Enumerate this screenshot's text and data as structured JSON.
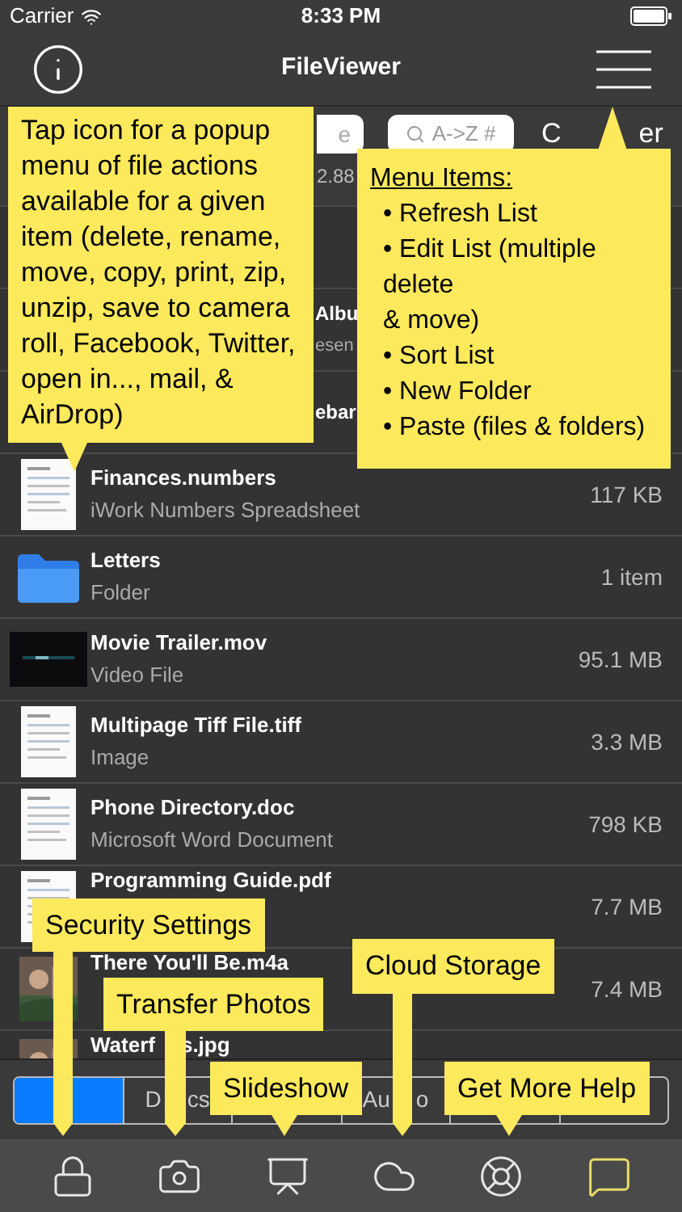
{
  "status_bar": {
    "carrier": "Carrier",
    "time": "8:33 PM"
  },
  "nav": {
    "title": "FileViewer"
  },
  "search": {
    "left_field_fragment": "e",
    "placeholder": "A->Z #",
    "clear_parts": [
      "C",
      "er"
    ],
    "free_space_fragment": "2.88"
  },
  "covered_rows": [
    {
      "title": "Albu",
      "subtitle": "esen"
    },
    {
      "title": "ebar"
    }
  ],
  "rows": [
    {
      "kind": "document",
      "title_parts": [
        "Finances.numbers"
      ],
      "subtitle": "iWork Numbers Spreadsheet",
      "size": "117 KB"
    },
    {
      "kind": "folder",
      "title_parts": [
        "Letters"
      ],
      "subtitle": "Folder",
      "size": "1 item"
    },
    {
      "kind": "video",
      "title_parts": [
        "Movie Trailer.mov"
      ],
      "subtitle": "Video File",
      "size": "95.1 MB"
    },
    {
      "kind": "document",
      "title_parts": [
        "Multipage Tiff File.tiff"
      ],
      "subtitle": "Image",
      "size": "3.3 MB"
    },
    {
      "kind": "document",
      "title_parts": [
        "Phone Directory.doc"
      ],
      "subtitle": "Microsoft Word Document",
      "size": "798 KB"
    },
    {
      "kind": "document",
      "title_parts": [
        "Programming Guide.pdf"
      ],
      "size": "7.7 MB"
    },
    {
      "title_parts": [
        "There You'll Be.m4a"
      ],
      "size": "7.4 MB"
    },
    {
      "title_parts": [
        "Waterf",
        "s.jpg"
      ]
    }
  ],
  "segments": [
    {
      "selected": true
    },
    {
      "label_parts": [
        "D",
        "cs"
      ],
      "selected": false
    },
    {
      "selected": false
    },
    {
      "label_parts": [
        "Au",
        "o"
      ],
      "selected": false
    },
    {
      "selected": false
    },
    {
      "selected": false
    }
  ],
  "tab_bar": [
    {
      "kind": "lock",
      "selected": false
    },
    {
      "kind": "camera",
      "selected": false
    },
    {
      "kind": "slideshow",
      "selected": false
    },
    {
      "kind": "cloud",
      "selected": false
    },
    {
      "kind": "help",
      "selected": false
    },
    {
      "kind": "feedback",
      "selected": true
    }
  ],
  "callouts": {
    "file_actions": "Tap icon for a popup menu of file actions available for a given item (delete, rename, move, copy, print, zip, unzip, save to camera roll, Facebook, Twitter, open in..., mail, & AirDrop)",
    "menu_title": "Menu Items:",
    "menu_items": [
      "• Refresh List",
      "• Edit List (multiple\ndelete\n & move)",
      "• Sort List",
      "• New Folder",
      "• Paste (files & folders)"
    ],
    "security": "Security Settings",
    "transfer": "Transfer Photos",
    "cloud": "Cloud Storage",
    "slideshow": "Slideshow",
    "help": "Get More Help"
  }
}
